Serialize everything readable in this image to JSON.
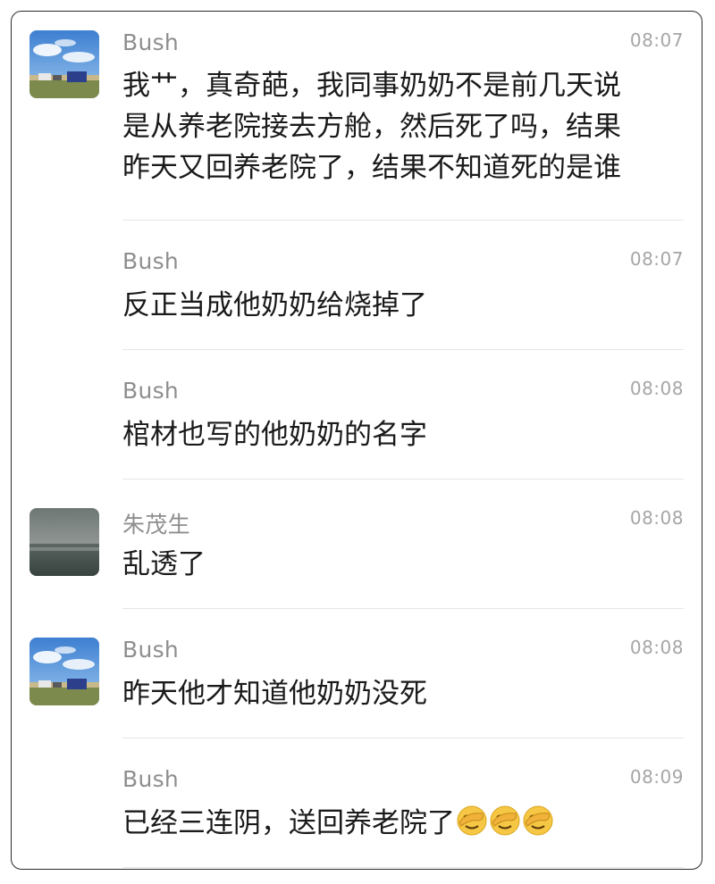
{
  "messages": [
    {
      "sender": "Bush",
      "time": "08:07",
      "avatar": "beach-photo",
      "lines": [
        "我艹，真奇葩，我同事奶奶不是前几天说",
        "是从养老院接去方舱，然后死了吗，结果",
        "昨天又回养老院了，结果不知道死的是谁"
      ]
    },
    {
      "sender": "Bush",
      "time": "08:07",
      "lines": [
        "反正当成他奶奶给烧掉了"
      ]
    },
    {
      "sender": "Bush",
      "time": "08:08",
      "lines": [
        "棺材也写的他奶奶的名字"
      ]
    },
    {
      "sender": "朱茂生",
      "time": "08:08",
      "avatar": "foggy-landscape-photo",
      "lines": [
        "乱透了"
      ]
    },
    {
      "sender": "Bush",
      "time": "08:08",
      "avatar": "beach-photo",
      "lines": [
        "昨天他才知道他奶奶没死"
      ]
    },
    {
      "sender": "Bush",
      "time": "08:09",
      "lines": [
        "已经三连阴，送回养老院了"
      ],
      "trailing_emoji": [
        "facepalm-emoji",
        "facepalm-emoji",
        "facepalm-emoji"
      ]
    }
  ]
}
